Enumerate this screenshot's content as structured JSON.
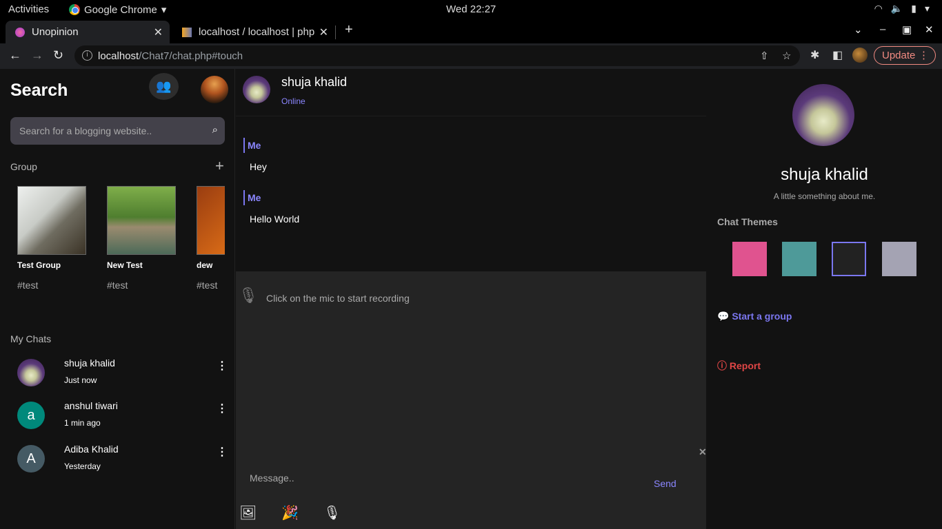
{
  "os": {
    "activities": "Activities",
    "app_name": "Google Chrome",
    "clock": "Wed 22:27"
  },
  "browser": {
    "tabs": [
      {
        "title": "Unopinion",
        "active": true
      },
      {
        "title": "localhost / localhost | php",
        "active": false
      }
    ],
    "url_host": "localhost",
    "url_path": "/Chat7/chat.php#touch",
    "update_label": "Update"
  },
  "sidebar": {
    "title": "Search",
    "search_placeholder": "Search for a blogging website..",
    "group_label": "Group",
    "groups": [
      {
        "name": "Test Group",
        "tag": "#test"
      },
      {
        "name": "New Test",
        "tag": "#test"
      },
      {
        "name": "dew",
        "tag": "#test"
      }
    ],
    "my_chats_label": "My Chats",
    "chats": [
      {
        "name": "shuja khalid",
        "time": "Just now",
        "initial": ""
      },
      {
        "name": "anshul tiwari",
        "time": "1 min ago",
        "initial": "a",
        "color": "#00897b"
      },
      {
        "name": "Adiba Khalid",
        "time": "Yesterday",
        "initial": "A",
        "color": "#455a64"
      }
    ]
  },
  "conversation": {
    "name": "shuja khalid",
    "status": "Online",
    "messages": [
      {
        "sender": "Me",
        "text": "Hey"
      },
      {
        "sender": "Me",
        "text": "Hello World"
      }
    ],
    "recording_hint": "Click on the mic to start recording",
    "message_placeholder": "Message..",
    "send_label": "Send"
  },
  "profile": {
    "name": "shuja khalid",
    "about": "A little something about me.",
    "themes_label": "Chat Themes",
    "themes": [
      "#e0538f",
      "#4e9a99",
      "#222222",
      "#a4a3b3"
    ],
    "selected_theme": 2,
    "start_group_label": "Start a group",
    "report_label": "Report",
    "accent": "#7b77f0",
    "report_color": "#e04646"
  }
}
